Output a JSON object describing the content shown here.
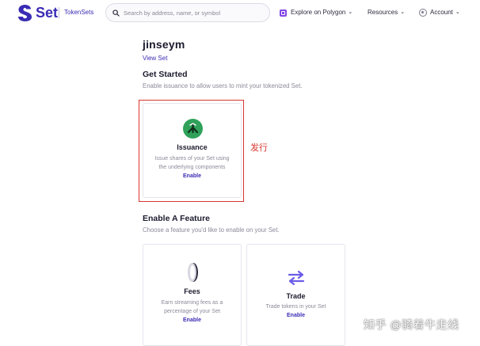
{
  "header": {
    "logo_text": "Set",
    "logo_sub": "TokenSets",
    "search_placeholder": "Search by address, name, or symbol",
    "explore_label": "Explore on Polygon",
    "resources_label": "Resources",
    "account_label": "Account"
  },
  "page": {
    "set_name": "jinseym",
    "view_set": "View Set",
    "get_started_title": "Get Started",
    "get_started_desc": "Enable issuance to allow users to mint your tokenized Set.",
    "feature_title": "Enable A Feature",
    "feature_desc": "Choose a feature you'd like to enable on your Set."
  },
  "issuance_card": {
    "title": "Issuance",
    "desc": "Issue shares of your Set using the underlying components",
    "enable": "Enable",
    "icon": "issuance-icon"
  },
  "feature_cards": [
    {
      "title": "Fees",
      "desc": "Earn streaming fees as a percentage of your Set",
      "enable": "Enable",
      "icon": "coin-icon"
    },
    {
      "title": "Trade",
      "desc": "Trade tokens in your Set",
      "enable": "Enable",
      "icon": "swap-arrows-icon"
    }
  ],
  "annotation": "发行",
  "watermark": "知乎 @骑着牛走线",
  "colors": {
    "brand": "#3a2bb4",
    "issuance_green": "#2fa15a",
    "highlight_red": "#d9362f",
    "trade_purple": "#6b5ce7",
    "polygon": "#8247e5"
  }
}
